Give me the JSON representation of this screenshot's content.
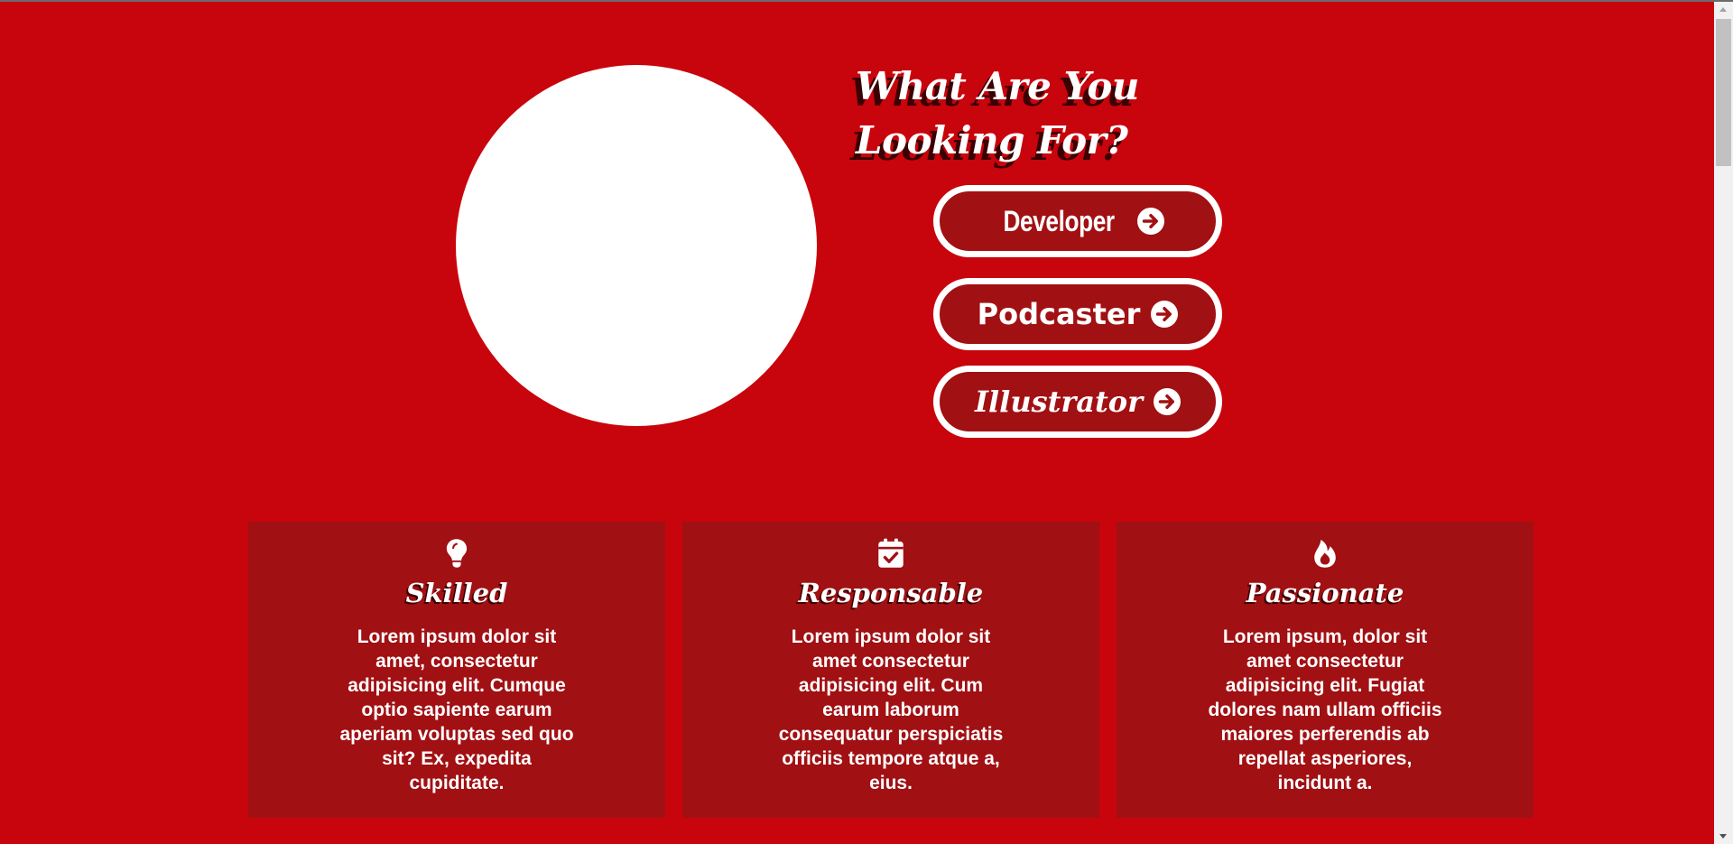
{
  "hero": {
    "heading": "What Are You Looking For?",
    "buttons": [
      {
        "label": "Developer",
        "icon": "arrow-circle-right-icon"
      },
      {
        "label": "Podcaster",
        "icon": "arrow-circle-right-icon"
      },
      {
        "label": "Illustrator",
        "icon": "arrow-circle-right-icon"
      }
    ]
  },
  "features": [
    {
      "icon": "lightbulb-icon",
      "title": "Skilled",
      "text": "Lorem ipsum dolor sit amet, consectetur adipisicing elit. Cumque optio sapiente earum aperiam voluptas sed quo sit? Ex, expedita cupiditate."
    },
    {
      "icon": "calendar-check-icon",
      "title": "Responsable",
      "text": "Lorem ipsum dolor sit amet consectetur adipisicing elit. Cum earum laborum consequatur perspiciatis officiis tempore atque a, eius."
    },
    {
      "icon": "flame-icon",
      "title": "Passionate",
      "text": "Lorem ipsum, dolor sit amet consectetur adipisicing elit. Fugiat dolores nam ullam officiis maiores perferendis ab repellat asperiores, incidunt a."
    }
  ],
  "colors": {
    "background": "#c8040c",
    "card": "#a11013",
    "accent": "#ffffff",
    "shadow": "#3a0003"
  }
}
